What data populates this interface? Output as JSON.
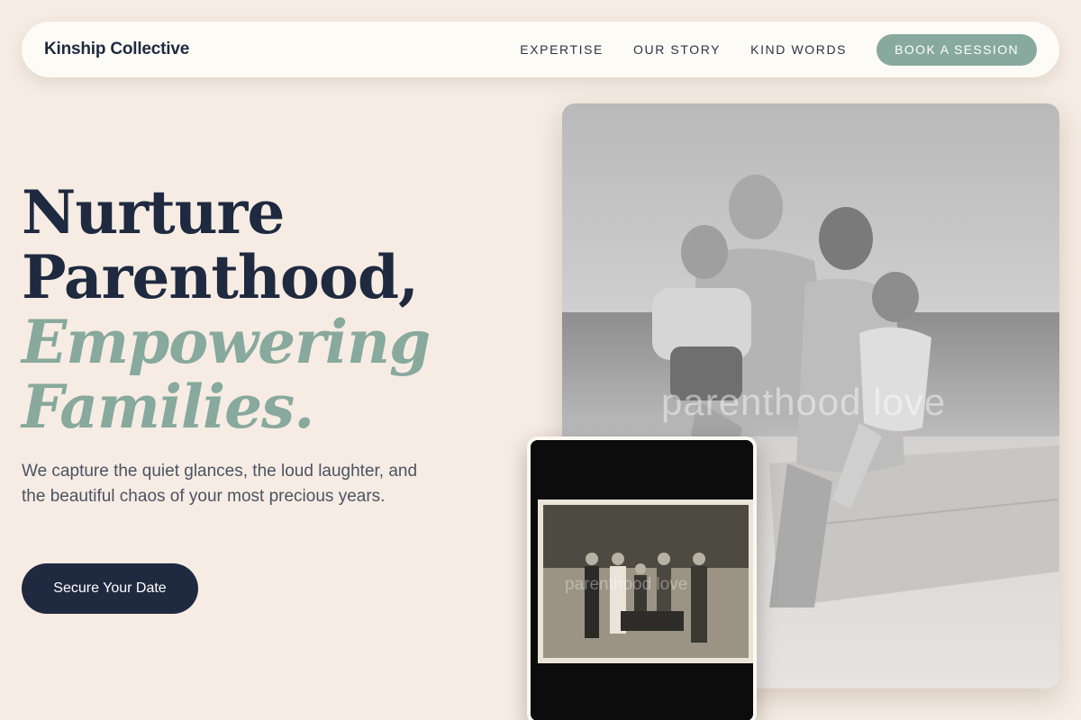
{
  "nav": {
    "brand": "Kinship Collective",
    "links": [
      "EXPERTISE",
      "OUR STORY",
      "KIND WORDS"
    ],
    "cta": "BOOK A SESSION"
  },
  "hero": {
    "headline_line1": "Nurture",
    "headline_line2": "Parenthood,",
    "headline_line3": "Empowering",
    "headline_line4": "Families.",
    "subcopy": "We capture the quiet glances, the loud laughter, and the beautiful chaos of your most precious years.",
    "cta": "Secure Your Date"
  },
  "photos": {
    "main_watermark": "parenthood love",
    "small_watermark": "parenthood love"
  },
  "colors": {
    "background": "#f6ece3",
    "navy": "#1f2a40",
    "sage": "#88a99d"
  }
}
